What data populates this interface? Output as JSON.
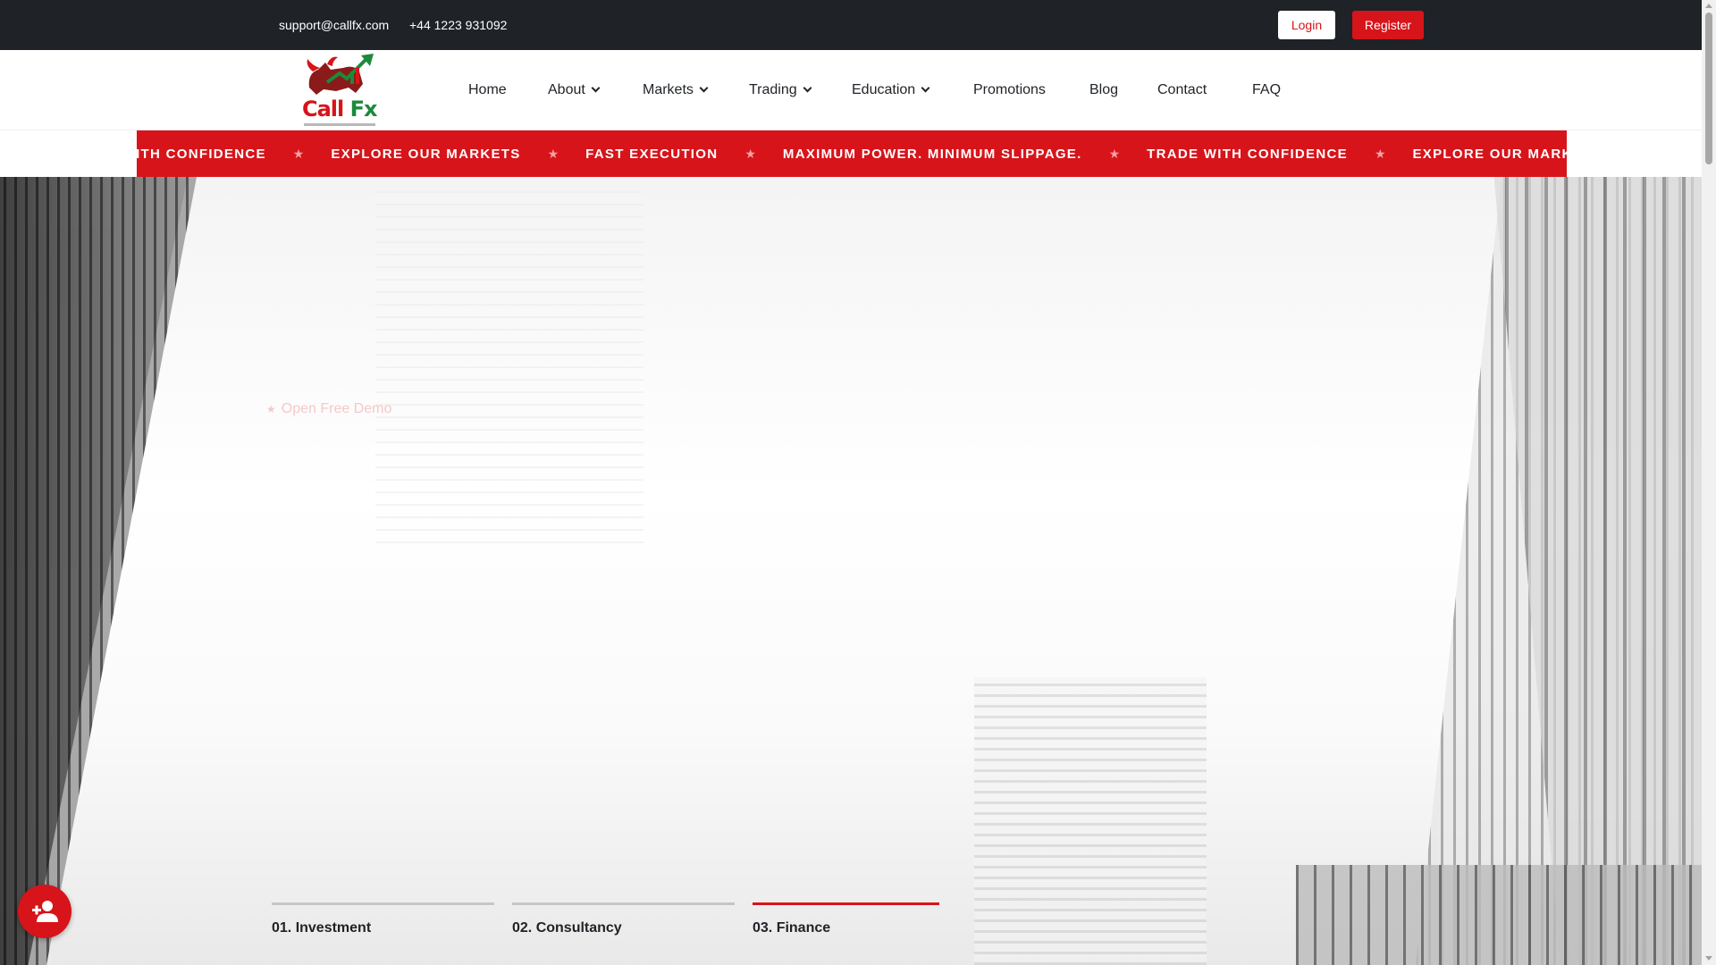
{
  "topbar": {
    "email": "support@callfx.com",
    "phone": "+44 1223 931092",
    "login_label": "Login",
    "register_label": "Register"
  },
  "logo": {
    "brand_call": "Call ",
    "brand_fx": "Fx"
  },
  "nav": {
    "items": [
      {
        "label": "Home",
        "has_dropdown": false
      },
      {
        "label": "About",
        "has_dropdown": true
      },
      {
        "label": "Markets",
        "has_dropdown": true
      },
      {
        "label": "Trading",
        "has_dropdown": true
      },
      {
        "label": "Education",
        "has_dropdown": true
      },
      {
        "label": "Promotions",
        "has_dropdown": false
      },
      {
        "label": "Blog",
        "has_dropdown": false
      },
      {
        "label": "Contact",
        "has_dropdown": false
      },
      {
        "label": "FAQ",
        "has_dropdown": false
      }
    ]
  },
  "ticker": {
    "items": [
      "TRADE WITH CONFIDENCE",
      "EXPLORE OUR MARKETS",
      "FAST EXECUTION",
      "MAXIMUM POWER. MINIMUM SLIPPAGE.",
      "TRADE WITH CONFIDENCE",
      "EXPLORE OUR MARKETS"
    ],
    "separator": "★"
  },
  "hero": {
    "demo_link": "Open Free Demo",
    "demo_star": "★",
    "tabs": [
      {
        "label": "01. Investment",
        "active": false
      },
      {
        "label": "02. Consultancy",
        "active": false
      },
      {
        "label": "03. Finance",
        "active": true
      }
    ]
  },
  "colors": {
    "brand_red": "#d7141a",
    "topbar_bg": "#1f2226",
    "brand_green": "#1b8a3a"
  },
  "icons": {
    "fab": "add-user-icon",
    "logo": "bull-logo-icon"
  }
}
